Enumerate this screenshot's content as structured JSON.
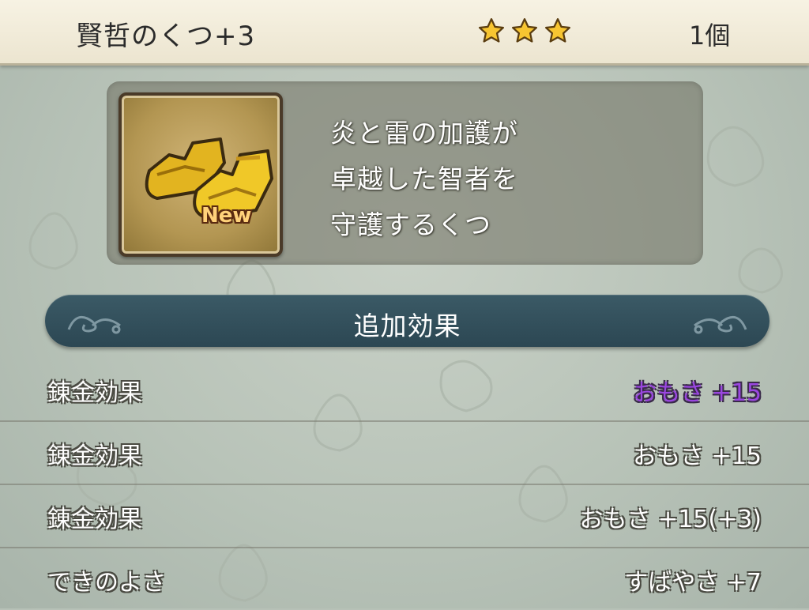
{
  "header": {
    "item_name": "賢哲のくつ+3",
    "star_count": 3,
    "count_label": "1個"
  },
  "item": {
    "icon": "golden-boots-icon",
    "badge": "New",
    "description_lines": [
      "炎と雷の加護が",
      "卓越した智者を",
      "守護するくつ"
    ]
  },
  "section": {
    "title": "追加効果"
  },
  "effects": [
    {
      "label": "錬金効果",
      "value": "おもさ +15",
      "highlight": true
    },
    {
      "label": "錬金効果",
      "value": "おもさ +15",
      "highlight": false
    },
    {
      "label": "錬金効果",
      "value": "おもさ +15(+3)",
      "highlight": false
    },
    {
      "label": "できのよさ",
      "value": "すばやさ +7",
      "highlight": false
    }
  ],
  "colors": {
    "highlight_value": "#9a47e0",
    "star": "#f7c531",
    "section_bar": "#2f4b57"
  }
}
